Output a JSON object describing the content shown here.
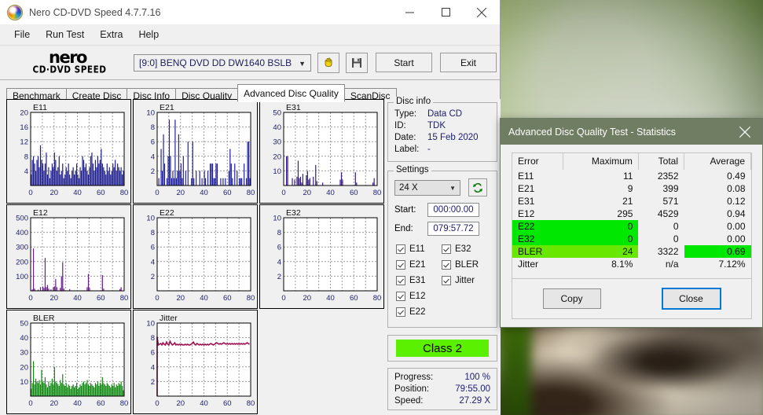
{
  "window": {
    "title": "Nero CD-DVD Speed 4.7.7.16",
    "icon": "nero-disc-icon",
    "minimize": "minimize-icon",
    "maximize": "maximize-icon",
    "close": "close-icon"
  },
  "menubar": {
    "items": [
      "File",
      "Run Test",
      "Extra",
      "Help"
    ]
  },
  "toolbar": {
    "logo_word": "nero",
    "logo_sub": "CD·DVD  SPEED",
    "drive": "[9:0]   BENQ DVD DD DW1640 BSLB",
    "icon_eject": "eject-hand-icon",
    "icon_save": "floppy-save-icon",
    "start_label": "Start",
    "exit_label": "Exit"
  },
  "tabs": {
    "items": [
      "Benchmark",
      "Create Disc",
      "Disc Info",
      "Disc Quality",
      "Advanced Disc Quality",
      "ScanDisc"
    ],
    "active": "Advanced Disc Quality"
  },
  "disc_info": {
    "legend": "Disc info",
    "rows": [
      {
        "key": "Type:",
        "value": "Data CD"
      },
      {
        "key": "ID:",
        "value": "TDK"
      },
      {
        "key": "Date:",
        "value": "15 Feb 2020"
      },
      {
        "key": "Label:",
        "value": "-"
      }
    ]
  },
  "settings": {
    "legend": "Settings",
    "speed": "24 X",
    "refresh_icon": "refresh-icon",
    "start_label": "Start:",
    "start_value": "000:00.00",
    "end_label": "End:",
    "end_value": "079:57.72",
    "checkboxes_left": [
      "E11",
      "E21",
      "E31",
      "E12",
      "E22"
    ],
    "checkboxes_right": [
      "E32",
      "BLER",
      "Jitter"
    ]
  },
  "class_result": "Class 2",
  "progress": {
    "rows": [
      {
        "key": "Progress:",
        "value": "100 %"
      },
      {
        "key": "Position:",
        "value": "79:55.00"
      },
      {
        "key": "Speed:",
        "value": "27.29 X"
      }
    ]
  },
  "dialog": {
    "title": "Advanced Disc Quality Test - Statistics",
    "close_icon": "close-icon",
    "columns": [
      "Error",
      "Maximum",
      "Total",
      "Average"
    ],
    "rows": [
      {
        "error": "E11",
        "maximum": "11",
        "total": "2352",
        "average": "0.49",
        "hl": "none"
      },
      {
        "error": "E21",
        "maximum": "9",
        "total": "399",
        "average": "0.08",
        "hl": "none"
      },
      {
        "error": "E31",
        "maximum": "21",
        "total": "571",
        "average": "0.12",
        "hl": "none"
      },
      {
        "error": "E12",
        "maximum": "295",
        "total": "4529",
        "average": "0.94",
        "hl": "none"
      },
      {
        "error": "E22",
        "maximum": "0",
        "total": "0",
        "average": "0.00",
        "hl": "green-left"
      },
      {
        "error": "E32",
        "maximum": "0",
        "total": "0",
        "average": "0.00",
        "hl": "green-left"
      },
      {
        "error": "BLER",
        "maximum": "24",
        "total": "3322",
        "average": "0.69",
        "hl": "green-left-and-avg"
      },
      {
        "error": "Jitter",
        "maximum": "8.1%",
        "total": "n/a",
        "average": "7.12%",
        "hl": "none"
      }
    ],
    "copy_label": "Copy",
    "close_label": "Close"
  },
  "colors": {
    "bar_e11": "#1f1f8f",
    "bar_e21": "#2222a0",
    "bar_e31": "#3a1f8a",
    "bar_e12": "#6b1f8f",
    "bar_bler": "#0f8a10",
    "line_jitter": "#a01050",
    "highlight_green": "#00e800",
    "highlight_green_light": "#68e800",
    "class_green": "#5bf000",
    "dialog_titlebar": "#6f7d63",
    "accent_blue": "#0078d7"
  },
  "chart_data": [
    {
      "type": "bar",
      "title": "E11",
      "xlabel": "",
      "ylabel": "",
      "xlim": [
        0,
        80
      ],
      "ylim": [
        0,
        20
      ],
      "xticks": [
        0,
        20,
        40,
        60,
        80
      ],
      "yticks": [
        4,
        8,
        12,
        16,
        20
      ],
      "color": "#1f1f8f",
      "grid": true,
      "x": [
        0,
        1,
        2,
        3,
        4,
        5,
        6,
        7,
        8,
        9,
        10,
        11,
        12,
        13,
        14,
        15,
        16,
        17,
        18,
        19,
        20,
        21,
        22,
        23,
        24,
        25,
        26,
        27,
        28,
        29,
        30,
        31,
        32,
        33,
        34,
        35,
        36,
        37,
        38,
        39,
        40,
        41,
        42,
        43,
        44,
        45,
        46,
        47,
        48,
        49,
        50,
        51,
        52,
        53,
        54,
        55,
        56,
        57,
        58,
        59,
        60,
        61,
        62,
        63,
        64,
        65,
        66,
        67,
        68,
        69,
        70,
        71,
        72,
        73,
        74,
        75,
        76,
        77,
        78,
        79
      ],
      "values": [
        3,
        7,
        8,
        6,
        4,
        7,
        8,
        5,
        11,
        7,
        6,
        4,
        6,
        9,
        3,
        5,
        2,
        4,
        6,
        5,
        9,
        7,
        4,
        5,
        8,
        3,
        4,
        6,
        2,
        3,
        5,
        4,
        6,
        3,
        2,
        4,
        5,
        3,
        4,
        6,
        3,
        2,
        5,
        4,
        8,
        7,
        5,
        6,
        4,
        3,
        5,
        8,
        9,
        6,
        4,
        7,
        5,
        8,
        6,
        7,
        10,
        6,
        5,
        4,
        3,
        6,
        4,
        5,
        3,
        4,
        6,
        5,
        7,
        4,
        6,
        5,
        4,
        5,
        3,
        4
      ]
    },
    {
      "type": "bar",
      "title": "E21",
      "xlabel": "",
      "ylabel": "",
      "xlim": [
        0,
        80
      ],
      "ylim": [
        0,
        10
      ],
      "xticks": [
        0,
        20,
        40,
        60,
        80
      ],
      "yticks": [
        2,
        4,
        6,
        8,
        10
      ],
      "color": "#2222a0",
      "grid": true,
      "x": [
        1,
        3,
        4,
        5,
        6,
        8,
        9,
        10,
        11,
        12,
        13,
        14,
        15,
        16,
        17,
        18,
        19,
        20,
        21,
        22,
        24,
        26,
        29,
        30,
        31,
        33,
        36,
        38,
        40,
        41,
        43,
        45,
        46,
        47,
        48,
        49,
        50,
        51,
        54,
        56,
        58,
        61,
        62,
        63,
        64,
        66,
        68,
        70,
        71,
        72,
        74,
        76,
        77,
        78,
        79
      ],
      "values": [
        1,
        5,
        2,
        7,
        3,
        1,
        4,
        9,
        4,
        1,
        2,
        1,
        9,
        1,
        2,
        7,
        2,
        3,
        1,
        4,
        2,
        6,
        1,
        6,
        1,
        2,
        2,
        1,
        2,
        1,
        2,
        3,
        3,
        3,
        1,
        1,
        3,
        3,
        1,
        1,
        1,
        2,
        5,
        3,
        1,
        3,
        2,
        1,
        1,
        1,
        3,
        1,
        6,
        6,
        1
      ]
    },
    {
      "type": "bar",
      "title": "E31",
      "xlabel": "",
      "ylabel": "",
      "xlim": [
        0,
        80
      ],
      "ylim": [
        0,
        50
      ],
      "xticks": [
        0,
        20,
        40,
        60,
        80
      ],
      "yticks": [
        10,
        20,
        30,
        40,
        50
      ],
      "color": "#3a1f8a",
      "grid": true,
      "x": [
        2,
        3,
        7,
        9,
        11,
        12,
        13,
        14,
        15,
        16,
        19,
        20,
        21,
        22,
        25,
        27,
        28,
        33,
        48,
        49,
        50,
        61,
        62,
        76,
        77
      ],
      "values": [
        20,
        20,
        5,
        4,
        6,
        17,
        5,
        6,
        2,
        8,
        7,
        10,
        4,
        5,
        6,
        14,
        3,
        2,
        4,
        9,
        4,
        9,
        2,
        2,
        5
      ]
    },
    {
      "type": "bar",
      "title": "E12",
      "xlabel": "",
      "ylabel": "",
      "xlim": [
        0,
        80
      ],
      "ylim": [
        0,
        500
      ],
      "xticks": [
        0,
        20,
        40,
        60,
        80
      ],
      "yticks": [
        100,
        200,
        300,
        400,
        500
      ],
      "color": "#6b1f8f",
      "grid": true,
      "x": [
        1,
        2,
        3,
        6,
        8,
        10,
        11,
        12,
        13,
        14,
        15,
        17,
        19,
        20,
        21,
        22,
        25,
        26,
        27,
        28,
        33,
        48,
        49,
        50,
        61,
        62,
        76,
        77
      ],
      "values": [
        10,
        290,
        15,
        8,
        25,
        30,
        20,
        225,
        25,
        40,
        15,
        10,
        25,
        30,
        80,
        25,
        20,
        100,
        195,
        15,
        12,
        25,
        115,
        20,
        108,
        15,
        12,
        25
      ]
    },
    {
      "type": "bar",
      "title": "E22",
      "xlabel": "",
      "ylabel": "",
      "xlim": [
        0,
        80
      ],
      "ylim": [
        0,
        10
      ],
      "xticks": [
        0,
        20,
        40,
        60,
        80
      ],
      "yticks": [
        2,
        4,
        6,
        8,
        10
      ],
      "color": "#2222a0",
      "grid": true,
      "x": [],
      "values": []
    },
    {
      "type": "bar",
      "title": "E32",
      "xlabel": "",
      "ylabel": "",
      "xlim": [
        0,
        80
      ],
      "ylim": [
        0,
        10
      ],
      "xticks": [
        0,
        20,
        40,
        60,
        80
      ],
      "yticks": [
        2,
        4,
        6,
        8,
        10
      ],
      "color": "#2222a0",
      "grid": true,
      "x": [],
      "values": []
    },
    {
      "type": "bar",
      "title": "BLER",
      "xlabel": "",
      "ylabel": "",
      "xlim": [
        0,
        80
      ],
      "ylim": [
        0,
        50
      ],
      "xticks": [
        0,
        20,
        40,
        60,
        80
      ],
      "yticks": [
        10,
        20,
        30,
        40,
        50
      ],
      "color": "#0f8a10",
      "grid": true,
      "x": [
        0,
        1,
        2,
        3,
        4,
        5,
        6,
        7,
        8,
        9,
        10,
        11,
        12,
        13,
        14,
        15,
        16,
        17,
        18,
        19,
        20,
        21,
        22,
        23,
        24,
        25,
        26,
        27,
        28,
        29,
        30,
        31,
        32,
        33,
        34,
        35,
        36,
        37,
        38,
        39,
        40,
        41,
        42,
        43,
        44,
        45,
        46,
        47,
        48,
        49,
        50,
        51,
        52,
        53,
        54,
        55,
        56,
        57,
        58,
        59,
        60,
        61,
        62,
        63,
        64,
        65,
        66,
        67,
        68,
        69,
        70,
        71,
        72,
        73,
        74,
        75,
        76,
        77,
        78,
        79
      ],
      "values": [
        5,
        9,
        24,
        8,
        12,
        10,
        9,
        11,
        8,
        18,
        10,
        9,
        13,
        8,
        6,
        10,
        7,
        9,
        12,
        8,
        20,
        10,
        9,
        8,
        7,
        11,
        9,
        15,
        8,
        7,
        9,
        6,
        8,
        7,
        5,
        7,
        8,
        6,
        7,
        9,
        5,
        6,
        8,
        7,
        9,
        10,
        8,
        9,
        11,
        8,
        7,
        9,
        8,
        7,
        6,
        9,
        8,
        10,
        7,
        9,
        8,
        13,
        9,
        8,
        7,
        9,
        8,
        7,
        6,
        8,
        7,
        9,
        6,
        8,
        7,
        9,
        8,
        10,
        7,
        4
      ]
    },
    {
      "type": "line",
      "title": "Jitter",
      "xlabel": "",
      "ylabel": "",
      "xlim": [
        0,
        80
      ],
      "ylim": [
        0,
        10
      ],
      "xticks": [
        0,
        20,
        40,
        60,
        80
      ],
      "yticks": [
        2,
        4,
        6,
        8,
        10
      ],
      "color": "#a01050",
      "grid": true,
      "x": [
        0,
        1,
        2,
        3,
        4,
        5,
        6,
        7,
        8,
        9,
        10,
        11,
        12,
        13,
        14,
        15,
        16,
        17,
        18,
        19,
        20,
        21,
        22,
        23,
        24,
        25,
        26,
        27,
        28,
        29,
        30,
        31,
        32,
        33,
        34,
        35,
        36,
        37,
        38,
        39,
        40,
        41,
        42,
        43,
        44,
        45,
        46,
        47,
        48,
        49,
        50,
        51,
        52,
        53,
        54,
        55,
        56,
        57,
        58,
        59,
        60,
        61,
        62,
        63,
        64,
        65,
        66,
        67,
        68,
        69,
        70,
        71,
        72,
        73,
        74,
        75,
        76,
        77,
        78,
        79
      ],
      "values": [
        8.1,
        7.0,
        7.1,
        7.2,
        7.0,
        7.3,
        7.1,
        7.0,
        7.4,
        7.1,
        7.0,
        7.5,
        7.2,
        7.0,
        7.1,
        7.3,
        7.0,
        7.1,
        7.0,
        7.1,
        7.0,
        7.1,
        7.0,
        7.0,
        7.1,
        7.0,
        7.1,
        7.0,
        7.0,
        7.1,
        7.2,
        7.4,
        7.1,
        7.0,
        7.2,
        7.1,
        7.0,
        7.1,
        7.0,
        7.1,
        7.0,
        7.1,
        7.0,
        7.1,
        7.0,
        7.1,
        7.2,
        7.1,
        7.0,
        7.1,
        7.2,
        7.3,
        7.2,
        7.1,
        7.2,
        7.1,
        7.2,
        7.3,
        7.2,
        7.1,
        7.2,
        7.1,
        7.2,
        7.1,
        7.2,
        7.1,
        7.2,
        7.1,
        7.2,
        7.1,
        7.2,
        7.1,
        7.2,
        7.1,
        7.2,
        7.1,
        7.2,
        7.3,
        7.2,
        7.1
      ]
    }
  ]
}
